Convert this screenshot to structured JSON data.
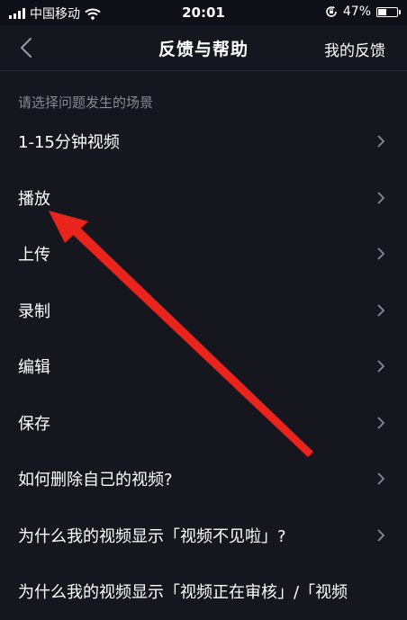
{
  "status_bar": {
    "carrier": "中国移动",
    "time": "20:01",
    "battery": "47%",
    "battery_level": 0.47
  },
  "nav": {
    "title": "反馈与帮助",
    "right_label": "我的反馈"
  },
  "section_label": "请选择问题发生的场景",
  "items": [
    {
      "label": "1-15分钟视频"
    },
    {
      "label": "播放"
    },
    {
      "label": "上传"
    },
    {
      "label": "录制"
    },
    {
      "label": "编辑"
    },
    {
      "label": "保存"
    },
    {
      "label": "如何删除自己的视频?"
    },
    {
      "label": "为什么我的视频显示「视频不见啦」?"
    },
    {
      "label": "为什么我的视频显示「视频正在审核」/「视频"
    }
  ],
  "colors": {
    "background": "#16161f",
    "annotation_arrow": "#e8241c",
    "secondary_text": "#8a8a94"
  },
  "icons": [
    "signal-icon",
    "wifi-icon",
    "rotation-lock-icon",
    "battery-icon",
    "back-chevron-icon",
    "chevron-right-icon"
  ]
}
